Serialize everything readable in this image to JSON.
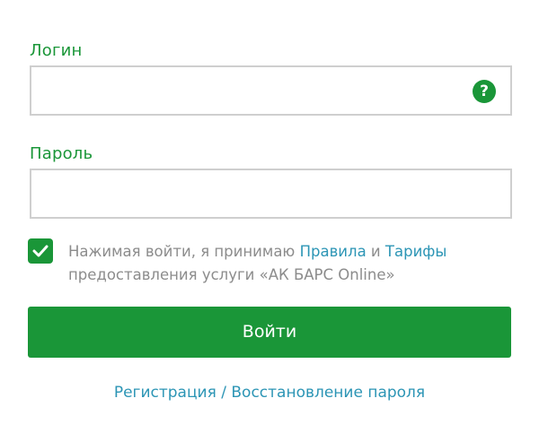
{
  "login": {
    "label": "Логин",
    "value": "",
    "placeholder": "",
    "help_icon": "?"
  },
  "password": {
    "label": "Пароль",
    "value": "",
    "placeholder": ""
  },
  "agreement": {
    "checked": true,
    "text_before": "Нажимая войти, я принимаю ",
    "rules_link": "Правила",
    "conjunction": " и ",
    "tariffs_link": "Тарифы",
    "text_after": " предоставления услуги «АК БАРС Online»"
  },
  "submit": {
    "label": "Войти"
  },
  "footer": {
    "register_link": "Регистрация",
    "separator": " / ",
    "restore_link": "Восстановление пароля"
  },
  "colors": {
    "accent_green": "#1a9638",
    "link_blue": "#2c95b5",
    "muted_text": "#8c8c8c",
    "input_border": "#cfcfcf"
  }
}
